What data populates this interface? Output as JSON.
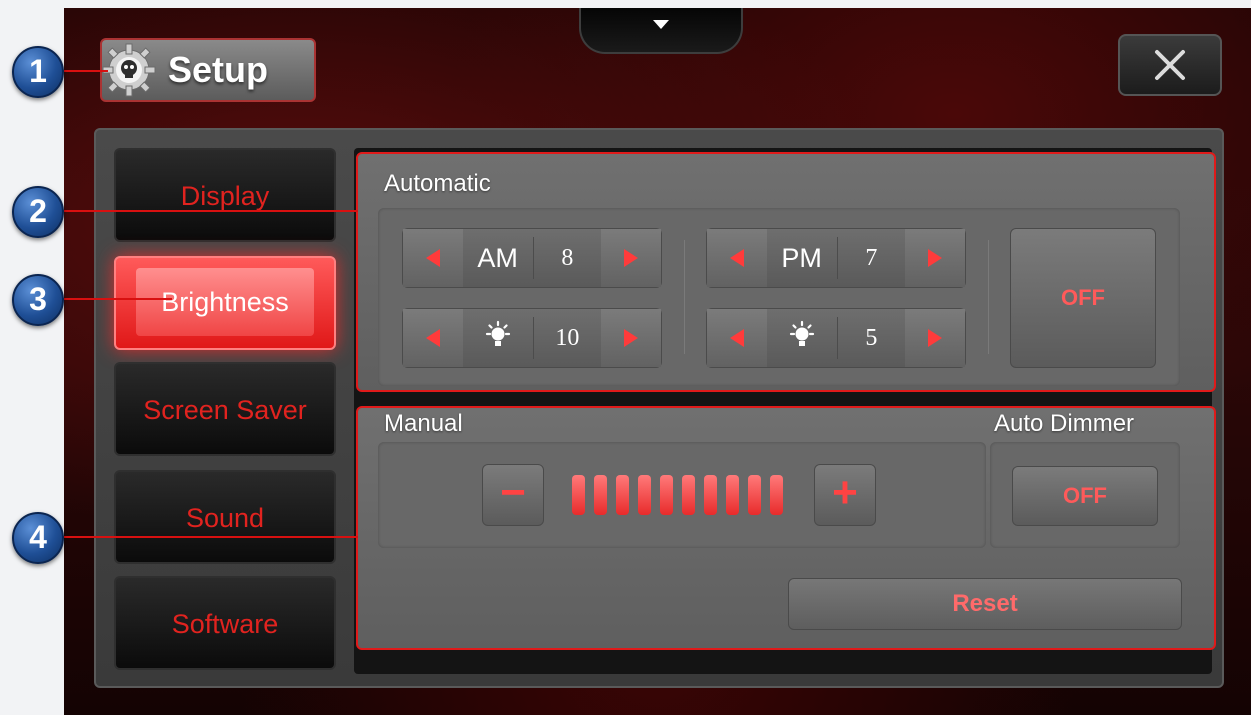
{
  "header": {
    "setup_label": "Setup",
    "close_icon": "close-icon",
    "notch_icon": "triangle-down-icon"
  },
  "callouts": [
    "1",
    "2",
    "3",
    "4"
  ],
  "sidebar": {
    "items": [
      {
        "label": "Display",
        "active": false
      },
      {
        "label": "Brightness",
        "active": true
      },
      {
        "label": "Screen Saver",
        "active": false
      },
      {
        "label": "Sound",
        "active": false
      },
      {
        "label": "Software",
        "active": false
      }
    ]
  },
  "automatic": {
    "title": "Automatic",
    "am": {
      "label": "AM",
      "value": "8",
      "brightness": "10"
    },
    "pm": {
      "label": "PM",
      "value": "7",
      "brightness": "5"
    },
    "off_label": "OFF"
  },
  "manual": {
    "title": "Manual",
    "level_segments": 10,
    "minus_label": "−",
    "plus_label": "+"
  },
  "auto_dimmer": {
    "title": "Auto Dimmer",
    "off_label": "OFF"
  },
  "reset_label": "Reset",
  "colors": {
    "accent": "#e01a1a",
    "callout": "#1f4f96"
  }
}
